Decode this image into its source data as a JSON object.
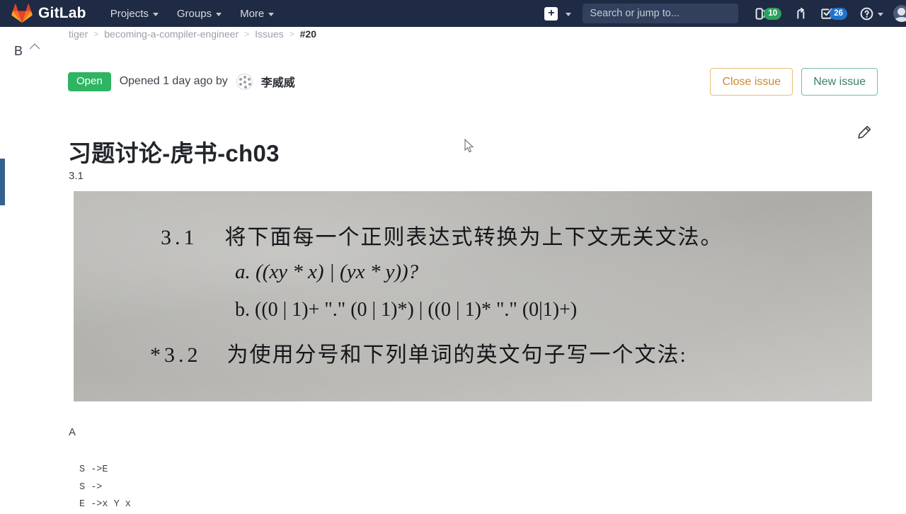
{
  "navbar": {
    "brand": "GitLab",
    "brand_icon": "gitlab-logo-icon",
    "items": [
      {
        "label": "Projects",
        "icon": "chevron-down-icon"
      },
      {
        "label": "Groups",
        "icon": "chevron-down-icon"
      },
      {
        "label": "More",
        "icon": "chevron-down-icon"
      }
    ],
    "create_new": {
      "icon": "plus-square-icon",
      "label": "+"
    },
    "search": {
      "placeholder": "Search or jump to...",
      "value": ""
    },
    "issues": {
      "icon": "issues-icon",
      "count": "10",
      "color": "#2da160"
    },
    "merge_requests": {
      "icon": "merge-request-icon"
    },
    "todos": {
      "icon": "todo-checkbox-icon",
      "count": "26",
      "color": "#1f75cb"
    },
    "help": {
      "icon": "question-circle-icon"
    },
    "user_avatar": "user-avatar-icon"
  },
  "rail": {
    "letter": "B",
    "chevron": "chevron-up-icon"
  },
  "breadcrumb": {
    "items": [
      "tiger",
      "becoming-a-compiler-engineer",
      "Issues"
    ],
    "separator": ">",
    "current": "#20"
  },
  "issue": {
    "state": "Open",
    "state_color": "#2fb463",
    "opened_text": "Opened 1 day ago by",
    "author": "李威威",
    "title": "习题讨论-虎书-ch03",
    "edit_icon": "pencil-edit-icon",
    "actions": {
      "close_label": "Close issue",
      "close_color": "#c98a2e",
      "new_label": "New issue",
      "new_color": "#3c7d6c"
    }
  },
  "description": {
    "para_31": "3.1",
    "para_a": "A",
    "photo": {
      "alt": "textbook-exercise-photo",
      "line1_num": "3.1",
      "line1_text": "将下面每一个正则表达式转换为上下文无关文法。",
      "line2": "a. ((xy * x) | (yx * y))?",
      "line3": "b. ((0 | 1)+ \".\" (0 | 1)*) | ((0 | 1)* \".\" (0|1)+)",
      "line4_num": "*3.2",
      "line4_text": "为使用分号和下列单词的英文句子写一个文法:"
    },
    "code_lines": [
      "S ->E",
      "S ->",
      "E ->x Y x"
    ]
  },
  "cursor": {
    "icon": "mouse-pointer-icon"
  }
}
